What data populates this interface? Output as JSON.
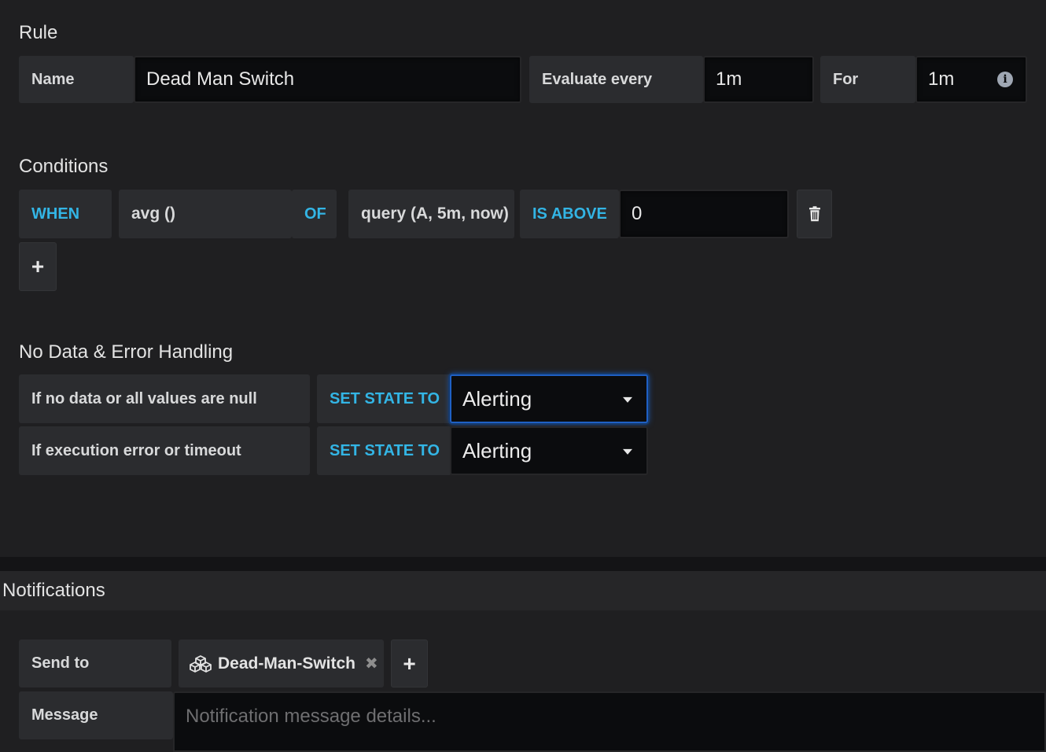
{
  "rule": {
    "title": "Rule",
    "name_label": "Name",
    "name_value": "Dead Man Switch",
    "evaluate_label": "Evaluate every",
    "evaluate_value": "1m",
    "for_label": "For",
    "for_value": "1m",
    "for_info_icon": "i"
  },
  "conditions": {
    "title": "Conditions",
    "when_label": "WHEN",
    "reducer": "avg ()",
    "of_label": "OF",
    "query": "query (A, 5m, now)",
    "evaluator": "IS ABOVE",
    "threshold": "0",
    "add_label": "+"
  },
  "no_data": {
    "title": "No Data & Error Handling",
    "rows": [
      {
        "label": "If no data or all values are null",
        "keyword": "SET STATE TO",
        "value": "Alerting"
      },
      {
        "label": "If execution error or timeout",
        "keyword": "SET STATE TO",
        "value": "Alerting"
      }
    ]
  },
  "notifications": {
    "title": "Notifications",
    "send_to_label": "Send to",
    "channel": "Dead-Man-Switch",
    "remove_glyph": "✖",
    "add_label": "+",
    "message_label": "Message",
    "message_placeholder": "Notification message details..."
  },
  "colors": {
    "background": "#1f1f21",
    "keyword_blue": "#33b5e5",
    "focus_blue": "#1f60c4"
  }
}
